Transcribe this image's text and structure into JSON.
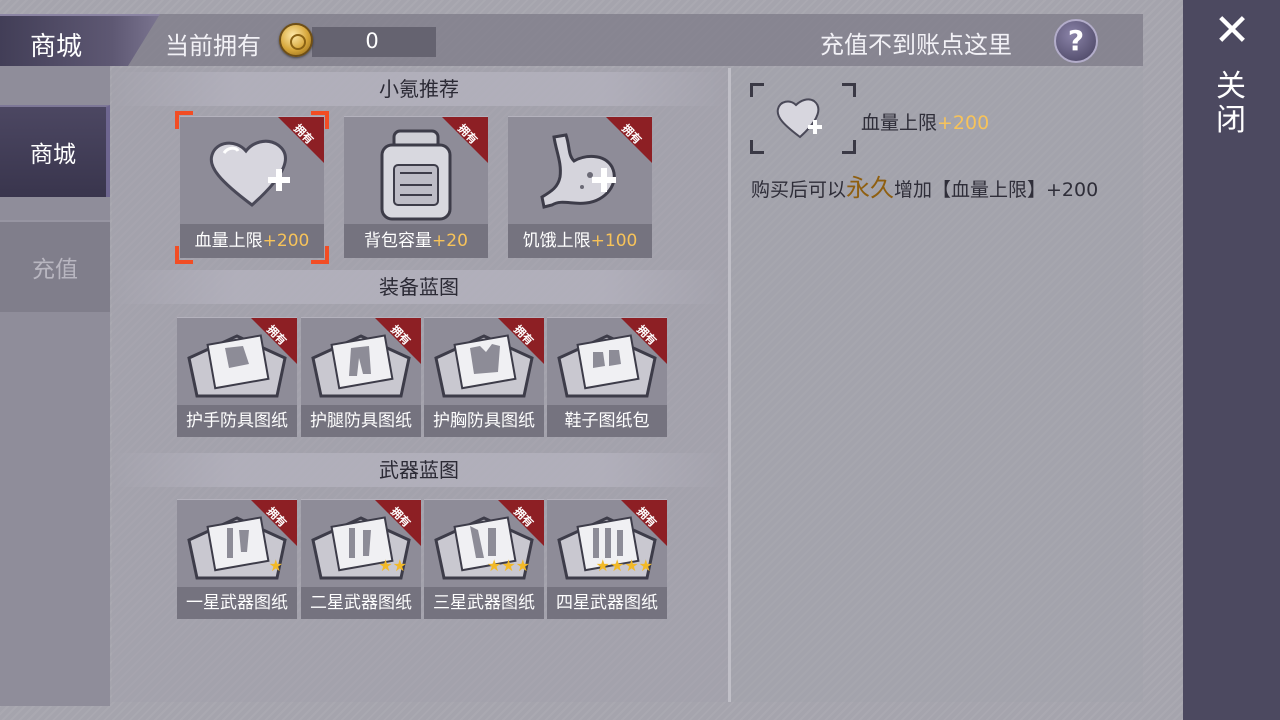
{
  "header": {
    "title": "商城",
    "currency_label": "当前拥有",
    "currency_value": "0",
    "help_text": "充值不到账点这里",
    "help_icon": "?"
  },
  "sidebar": {
    "items": [
      {
        "label": "商城",
        "active": true
      },
      {
        "label": "充值",
        "active": false
      }
    ]
  },
  "sections": [
    {
      "title": "小氪推荐",
      "items": [
        {
          "name": "血量上限",
          "bonus": "+200",
          "badge": "拥有",
          "icon": "heart-plus-icon",
          "selected": true
        },
        {
          "name": "背包容量",
          "bonus": "+20",
          "badge": "拥有",
          "icon": "backpack-icon",
          "selected": false
        },
        {
          "name": "饥饿上限",
          "bonus": "+100",
          "badge": "拥有",
          "icon": "stomach-plus-icon",
          "selected": false
        }
      ]
    },
    {
      "title": "装备蓝图",
      "items": [
        {
          "name": "护手防具图纸",
          "badge": "拥有",
          "icon": "blueprint-gloves-icon"
        },
        {
          "name": "护腿防具图纸",
          "badge": "拥有",
          "icon": "blueprint-pants-icon"
        },
        {
          "name": "护胸防具图纸",
          "badge": "拥有",
          "icon": "blueprint-vest-icon"
        },
        {
          "name": "鞋子图纸包",
          "badge": "拥有",
          "icon": "blueprint-shoes-icon"
        }
      ]
    },
    {
      "title": "武器蓝图",
      "items": [
        {
          "name": "一星武器图纸",
          "badge": "拥有",
          "icon": "blueprint-weapon-icon",
          "stars": 1
        },
        {
          "name": "二星武器图纸",
          "badge": "拥有",
          "icon": "blueprint-weapon-icon",
          "stars": 2
        },
        {
          "name": "三星武器图纸",
          "badge": "拥有",
          "icon": "blueprint-weapon-icon",
          "stars": 3
        },
        {
          "name": "四星武器图纸",
          "badge": "拥有",
          "icon": "blueprint-weapon-icon",
          "stars": 4
        }
      ]
    }
  ],
  "detail": {
    "name": "血量上限",
    "bonus": "+200",
    "desc_prefix": "购买后可以",
    "desc_emphasis": "永久",
    "desc_suffix": "增加【血量上限】+200",
    "icon": "heart-plus-icon"
  },
  "close": {
    "icon": "close-icon",
    "label": "关闭"
  },
  "colors": {
    "accent_bonus": "#f7c35a",
    "selection": "#f24d24",
    "owned_ribbon": "#8d1f24",
    "star": "#f2b928"
  }
}
